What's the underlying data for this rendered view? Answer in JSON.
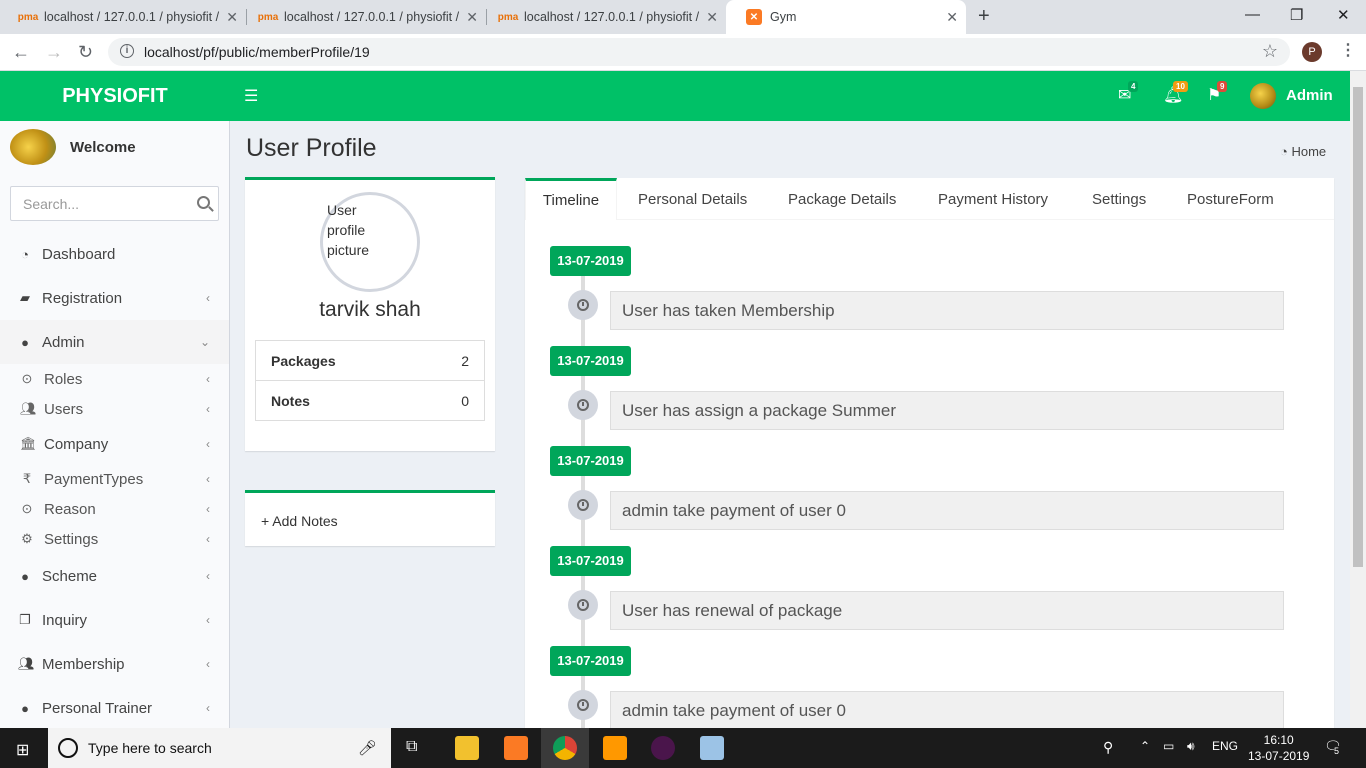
{
  "browser": {
    "tabs": [
      {
        "title": "localhost / 127.0.0.1 / physiofit /",
        "favicon": "phpmyadmin-icon"
      },
      {
        "title": "localhost / 127.0.0.1 / physiofit /",
        "favicon": "phpmyadmin-icon"
      },
      {
        "title": "localhost / 127.0.0.1 / physiofit /",
        "favicon": "phpmyadmin-icon"
      },
      {
        "title": "Gym",
        "favicon": "xampp-icon"
      }
    ],
    "url": "localhost/pf/public/memberProfile/19",
    "profile_initial": "P"
  },
  "topbar": {
    "brand": "PHYSIOFIT",
    "mail_count": "4",
    "bell_count": "10",
    "flag_count": "9",
    "user": "Admin",
    "colors": {
      "bar": "#00c167",
      "mail_badge": "#00a65a",
      "bell_badge": "#f39c12",
      "flag_badge": "#dd4b39"
    }
  },
  "sidebar": {
    "welcome": "Welcome",
    "search_placeholder": "Search...",
    "items": [
      {
        "label": "Dashboard",
        "icon": "dashboard-icon"
      },
      {
        "label": "Registration",
        "icon": "book-icon"
      },
      {
        "label": "Admin",
        "icon": "user-icon"
      },
      {
        "label": "Roles",
        "icon": "circle-dot-icon"
      },
      {
        "label": "Users",
        "icon": "users-icon"
      },
      {
        "label": "Company",
        "icon": "bank-icon"
      },
      {
        "label": "PaymentTypes",
        "icon": "rupee-icon"
      },
      {
        "label": "Reason",
        "icon": "circle-dot-icon"
      },
      {
        "label": "Settings",
        "icon": "gear-icon"
      },
      {
        "label": "Scheme",
        "icon": "user-icon"
      },
      {
        "label": "Inquiry",
        "icon": "copy-icon"
      },
      {
        "label": "Membership",
        "icon": "users-icon"
      },
      {
        "label": "Personal Trainer",
        "icon": "user-icon"
      }
    ]
  },
  "page": {
    "title": "User Profile",
    "breadcrumb": "Home"
  },
  "profile": {
    "image_alt": "User profile picture",
    "name": "tarvik shah",
    "stats": [
      {
        "label": "Packages",
        "value": "2"
      },
      {
        "label": "Notes",
        "value": "0"
      }
    ],
    "add_notes": "+ Add Notes"
  },
  "tabs": [
    "Timeline",
    "Personal Details",
    "Package Details",
    "Payment History",
    "Settings",
    "PostureForm"
  ],
  "timeline": [
    {
      "date": "13-07-2019",
      "text": "User has taken Membership"
    },
    {
      "date": "13-07-2019",
      "text": "User has assign a package Summer"
    },
    {
      "date": "13-07-2019",
      "text": "admin take payment of user 0"
    },
    {
      "date": "13-07-2019",
      "text": "User has renewal of package"
    },
    {
      "date": "13-07-2019",
      "text": "admin take payment of user 0"
    }
  ],
  "taskbar": {
    "search_placeholder": "Type here to search",
    "lang": "ENG",
    "time": "16:10",
    "date": "13-07-2019",
    "notifications": "5"
  }
}
